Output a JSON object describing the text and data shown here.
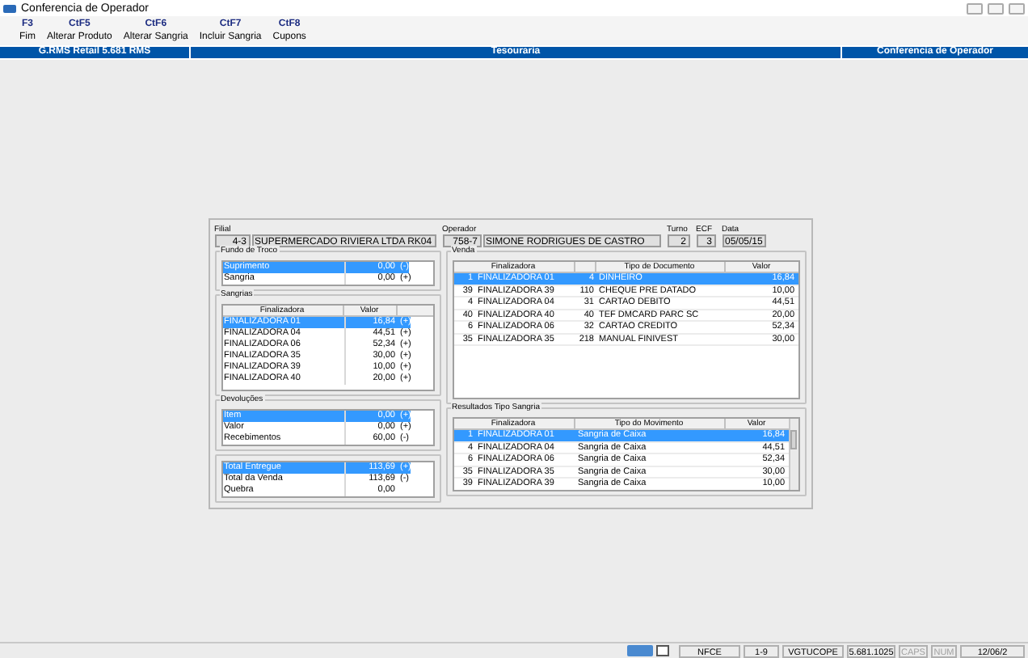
{
  "window": {
    "title": "Conferencia de Operador"
  },
  "toolbar": [
    {
      "key": "F3",
      "label": "Fim"
    },
    {
      "key": "CtF5",
      "label": "Alterar Produto"
    },
    {
      "key": "CtF6",
      "label": "Alterar Sangria"
    },
    {
      "key": "CtF7",
      "label": "Incluir Sangria"
    },
    {
      "key": "CtF8",
      "label": "Cupons"
    }
  ],
  "header_bar": {
    "left": "G.RMS Retail 5.681 RMS",
    "center": "Tesouraria",
    "right": "Conferencia de Operador"
  },
  "filial": {
    "label": "Filial",
    "code": "4-3",
    "name": "SUPERMERCADO RIVIERA LTDA RK04"
  },
  "operador": {
    "label": "Operador",
    "code": "758-7",
    "name": "SIMONE RODRIGUES DE CASTRO"
  },
  "turno": {
    "label": "Turno",
    "value": "2"
  },
  "ecf": {
    "label": "ECF",
    "value": "3"
  },
  "data": {
    "label": "Data",
    "value": "05/05/15"
  },
  "fundo_de_troco": {
    "title": "Fundo de Troco",
    "rows": [
      {
        "label": "Suprimento",
        "value": "0,00",
        "sign": "(-)",
        "selected": true
      },
      {
        "label": "Sangria",
        "value": "0,00",
        "sign": "(+)",
        "selected": false
      }
    ]
  },
  "sangrias": {
    "title": "Sangrias",
    "columns": [
      "Finalizadora",
      "Valor"
    ],
    "rows": [
      {
        "label": "FINALIZADORA 01",
        "value": "16,84",
        "sign": "(+)",
        "selected": true
      },
      {
        "label": "FINALIZADORA 04",
        "value": "44,51",
        "sign": "(+)",
        "selected": false
      },
      {
        "label": "FINALIZADORA 06",
        "value": "52,34",
        "sign": "(+)",
        "selected": false
      },
      {
        "label": "FINALIZADORA 35",
        "value": "30,00",
        "sign": "(+)",
        "selected": false
      },
      {
        "label": "FINALIZADORA 39",
        "value": "10,00",
        "sign": "(+)",
        "selected": false
      },
      {
        "label": "FINALIZADORA 40",
        "value": "20,00",
        "sign": "(+)",
        "selected": false
      }
    ]
  },
  "devolucoes": {
    "title": "Devoluções",
    "rows": [
      {
        "label": "Item",
        "value": "0,00",
        "sign": "(+)",
        "selected": true
      },
      {
        "label": "Valor",
        "value": "0,00",
        "sign": "(+)",
        "selected": false
      },
      {
        "label": "Recebimentos",
        "value": "60,00",
        "sign": "(-)",
        "selected": false
      }
    ]
  },
  "totais": {
    "rows": [
      {
        "label": "Total Entregue",
        "value": "113,69",
        "sign": "(+)",
        "selected": true
      },
      {
        "label": "Total da Venda",
        "value": "113,69",
        "sign": "(-)",
        "selected": false
      },
      {
        "label": "Quebra",
        "value": "0,00",
        "selected": false
      }
    ]
  },
  "venda": {
    "title": "Venda",
    "columns": [
      "Finalizadora",
      "Tipo de Documento",
      "Valor"
    ],
    "rows": [
      {
        "fin_code": "1",
        "finalizadora": "FINALIZADORA 01",
        "doc_code": "4",
        "tipo": "DINHEIRO",
        "valor": "16,84",
        "selected": true
      },
      {
        "fin_code": "39",
        "finalizadora": "FINALIZADORA 39",
        "doc_code": "110",
        "tipo": "CHEQUE PRE DATADO",
        "valor": "10,00",
        "selected": false
      },
      {
        "fin_code": "4",
        "finalizadora": "FINALIZADORA 04",
        "doc_code": "31",
        "tipo": "CARTAO DEBITO",
        "valor": "44,51",
        "selected": false
      },
      {
        "fin_code": "40",
        "finalizadora": "FINALIZADORA 40",
        "doc_code": "40",
        "tipo": "TEF DMCARD PARC SC",
        "valor": "20,00",
        "selected": false
      },
      {
        "fin_code": "6",
        "finalizadora": "FINALIZADORA 06",
        "doc_code": "32",
        "tipo": "CARTAO CREDITO",
        "valor": "52,34",
        "selected": false
      },
      {
        "fin_code": "35",
        "finalizadora": "FINALIZADORA 35",
        "doc_code": "218",
        "tipo": "MANUAL FINIVEST",
        "valor": "30,00",
        "selected": false
      }
    ]
  },
  "resultados": {
    "title": "Resultados Tipo Sangria",
    "columns": [
      "Finalizadora",
      "Tipo do Movimento",
      "Valor"
    ],
    "rows": [
      {
        "fin_code": "1",
        "finalizadora": "FINALIZADORA 01",
        "tipo": "Sangria de Caixa",
        "valor": "16,84",
        "selected": true
      },
      {
        "fin_code": "4",
        "finalizadora": "FINALIZADORA 04",
        "tipo": "Sangria de Caixa",
        "valor": "44,51",
        "selected": false
      },
      {
        "fin_code": "6",
        "finalizadora": "FINALIZADORA 06",
        "tipo": "Sangria de Caixa",
        "valor": "52,34",
        "selected": false
      },
      {
        "fin_code": "35",
        "finalizadora": "FINALIZADORA 35",
        "tipo": "Sangria de Caixa",
        "valor": "30,00",
        "selected": false
      },
      {
        "fin_code": "39",
        "finalizadora": "FINALIZADORA 39",
        "tipo": "Sangria de Caixa",
        "valor": "10,00",
        "selected": false
      }
    ]
  },
  "status_bar": [
    {
      "text": "NFCE",
      "enabled": true
    },
    {
      "text": "1-9",
      "enabled": true
    },
    {
      "text": "VGTUCOPE",
      "enabled": true
    },
    {
      "text": "5.681.1025",
      "enabled": true
    },
    {
      "text": "CAPS",
      "enabled": false
    },
    {
      "text": "NUM",
      "enabled": false
    },
    {
      "text": "12/06/2",
      "enabled": true
    }
  ]
}
